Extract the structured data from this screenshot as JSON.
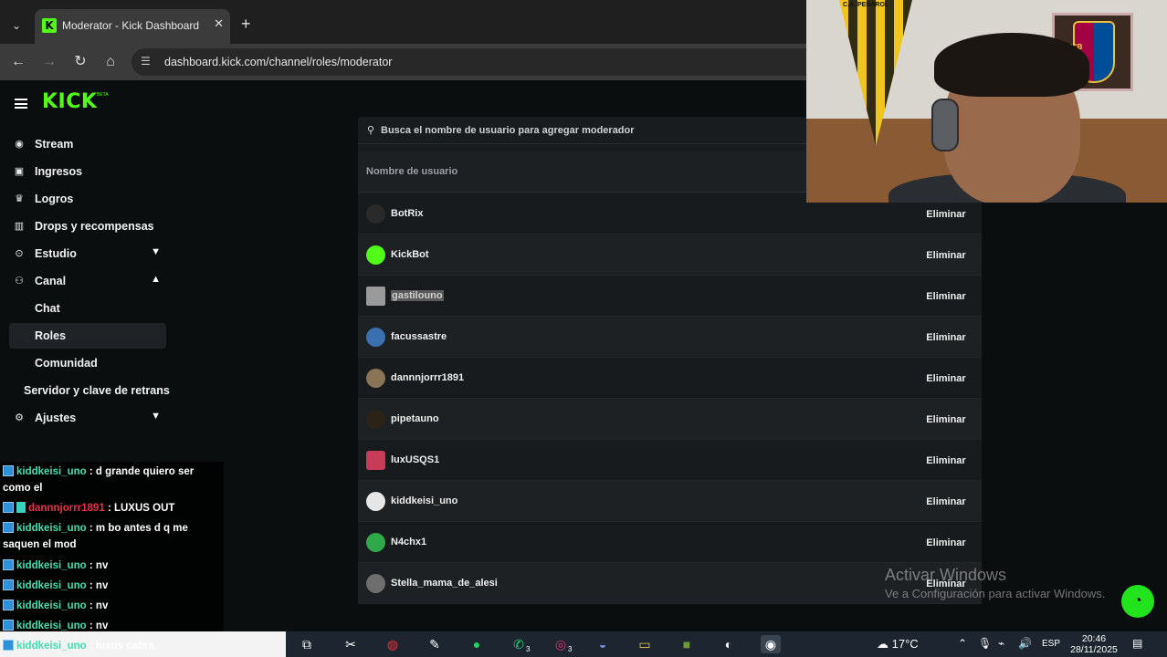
{
  "browser": {
    "tab_title": "Moderator - Kick Dashboard",
    "url": "dashboard.kick.com/channel/roles/moderator"
  },
  "brand": {
    "logo": "KICK",
    "beta": "BETA",
    "accent": "#53fc18"
  },
  "sidebar": {
    "items": [
      {
        "label": "Stream",
        "icon": "broadcast-icon"
      },
      {
        "label": "Ingresos",
        "icon": "revenue-icon"
      },
      {
        "label": "Logros",
        "icon": "trophy-icon"
      },
      {
        "label": "Drops y recompensas",
        "icon": "gift-icon"
      },
      {
        "label": "Estudio",
        "icon": "studio-icon"
      },
      {
        "label": "Canal",
        "icon": "channel-icon"
      },
      {
        "label": "Chat"
      },
      {
        "label": "Roles"
      },
      {
        "label": "Comunidad"
      },
      {
        "label": "Servidor y clave de retrans"
      },
      {
        "label": "Ajustes",
        "icon": "gear-icon"
      }
    ]
  },
  "moderators": {
    "search_placeholder": "Busca el nombre de usuario para agregar moderador",
    "column_username": "Nombre de usuario",
    "remove_label": "Eliminar",
    "rows": [
      {
        "username": "BotRix"
      },
      {
        "username": "KickBot"
      },
      {
        "username": "gastilouno"
      },
      {
        "username": "facussastre"
      },
      {
        "username": "dannnjorrr1891"
      },
      {
        "username": "pipetauno"
      },
      {
        "username": "luxUSQS1"
      },
      {
        "username": "kiddkeisi_uno"
      },
      {
        "username": "N4chx1"
      },
      {
        "username": "Stella_mama_de_alesi"
      }
    ]
  },
  "webcam": {
    "pennant_text": "C.A. PEÑAROL",
    "badge_text": "FCB"
  },
  "watermark": {
    "line1": "Activar Windows",
    "line2": "Ve a Configuración para activar Windows."
  },
  "chat": {
    "messages": [
      {
        "user": "kiddkeisi_uno",
        "text": ": d grande quiero ser como el"
      },
      {
        "user": "dannnjorrr1891",
        "text": ": LUXUS OUT"
      },
      {
        "user": "kiddkeisi_uno",
        "text": ": m bo antes d q me saquen el mod"
      },
      {
        "user": "kiddkeisi_uno",
        "text": ": nv"
      },
      {
        "user": "kiddkeisi_uno",
        "text": ": nv"
      },
      {
        "user": "kiddkeisi_uno",
        "text": ": nv"
      },
      {
        "user": "kiddkeisi_uno",
        "text": ": nv"
      },
      {
        "user": "kiddkeisi_uno",
        "text": ": luxus cabra"
      }
    ]
  },
  "taskbar": {
    "weather": "17°C",
    "lang": "ESP",
    "time": "20:46",
    "date": "28/11/2025",
    "whatsapp_count": "3",
    "instagram_count": "3"
  }
}
